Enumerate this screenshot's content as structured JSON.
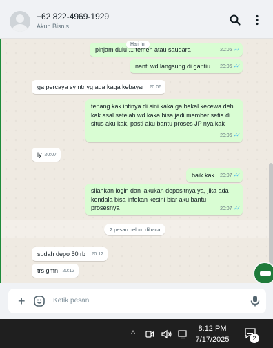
{
  "header": {
    "contact_name": "+62 822-4969-1929",
    "contact_subtitle": "Akun Bisnis",
    "icons": [
      "search-icon",
      "menu-dots-icon"
    ]
  },
  "chat": {
    "day_label": "Hari Ini",
    "unread_label": "2 pesan belum dibaca",
    "messages": [
      {
        "dir": "out",
        "text": "pinjam dulu ... temen atau saudara",
        "time": "20:06",
        "read": true
      },
      {
        "dir": "out",
        "text": "nanti wd langsung di gantiu",
        "time": "20:06",
        "read": true
      },
      {
        "dir": "in",
        "text": "ga percaya sy ntr yg ada kaga kebayar",
        "time": "20:06"
      },
      {
        "dir": "out",
        "text": "tenang kak intinya di sini kaka ga bakal kecewa deh kak asal setelah wd kaka bisa jadi member setia di situs aku kak, pasti aku bantu proses JP nya kak",
        "time": "20:06",
        "read": true
      },
      {
        "dir": "in",
        "text": "iy",
        "time": "20:07"
      },
      {
        "dir": "out",
        "text": "baik kak",
        "time": "20:07",
        "read": true
      },
      {
        "dir": "out",
        "text": "silahkan login dan lakukan depositnya ya, jika ada kendala bisa infokan kesini biar aku bantu prosesnya",
        "time": "20:07",
        "read": true
      },
      {
        "dir": "in",
        "text": "sudah depo 50 rb",
        "time": "20:12"
      },
      {
        "dir": "in",
        "text": "trs gmn",
        "time": "20:12"
      }
    ]
  },
  "composer": {
    "placeholder": "Ketik pesan",
    "icons": [
      "plus-icon",
      "emoji-icon",
      "mic-icon"
    ]
  },
  "taskbar": {
    "time": "8:12 PM",
    "date": "7/17/2025",
    "notification_count": "2",
    "tray_icons": [
      "chevron-up-icon",
      "meet-now-icon",
      "volume-icon",
      "network-icon",
      "notification-icon"
    ]
  },
  "colors": {
    "outgoing_bubble": "#d9fdd3",
    "incoming_bubble": "#ffffff",
    "read_ticks": "#53bdeb",
    "chat_background": "#efeae2"
  }
}
